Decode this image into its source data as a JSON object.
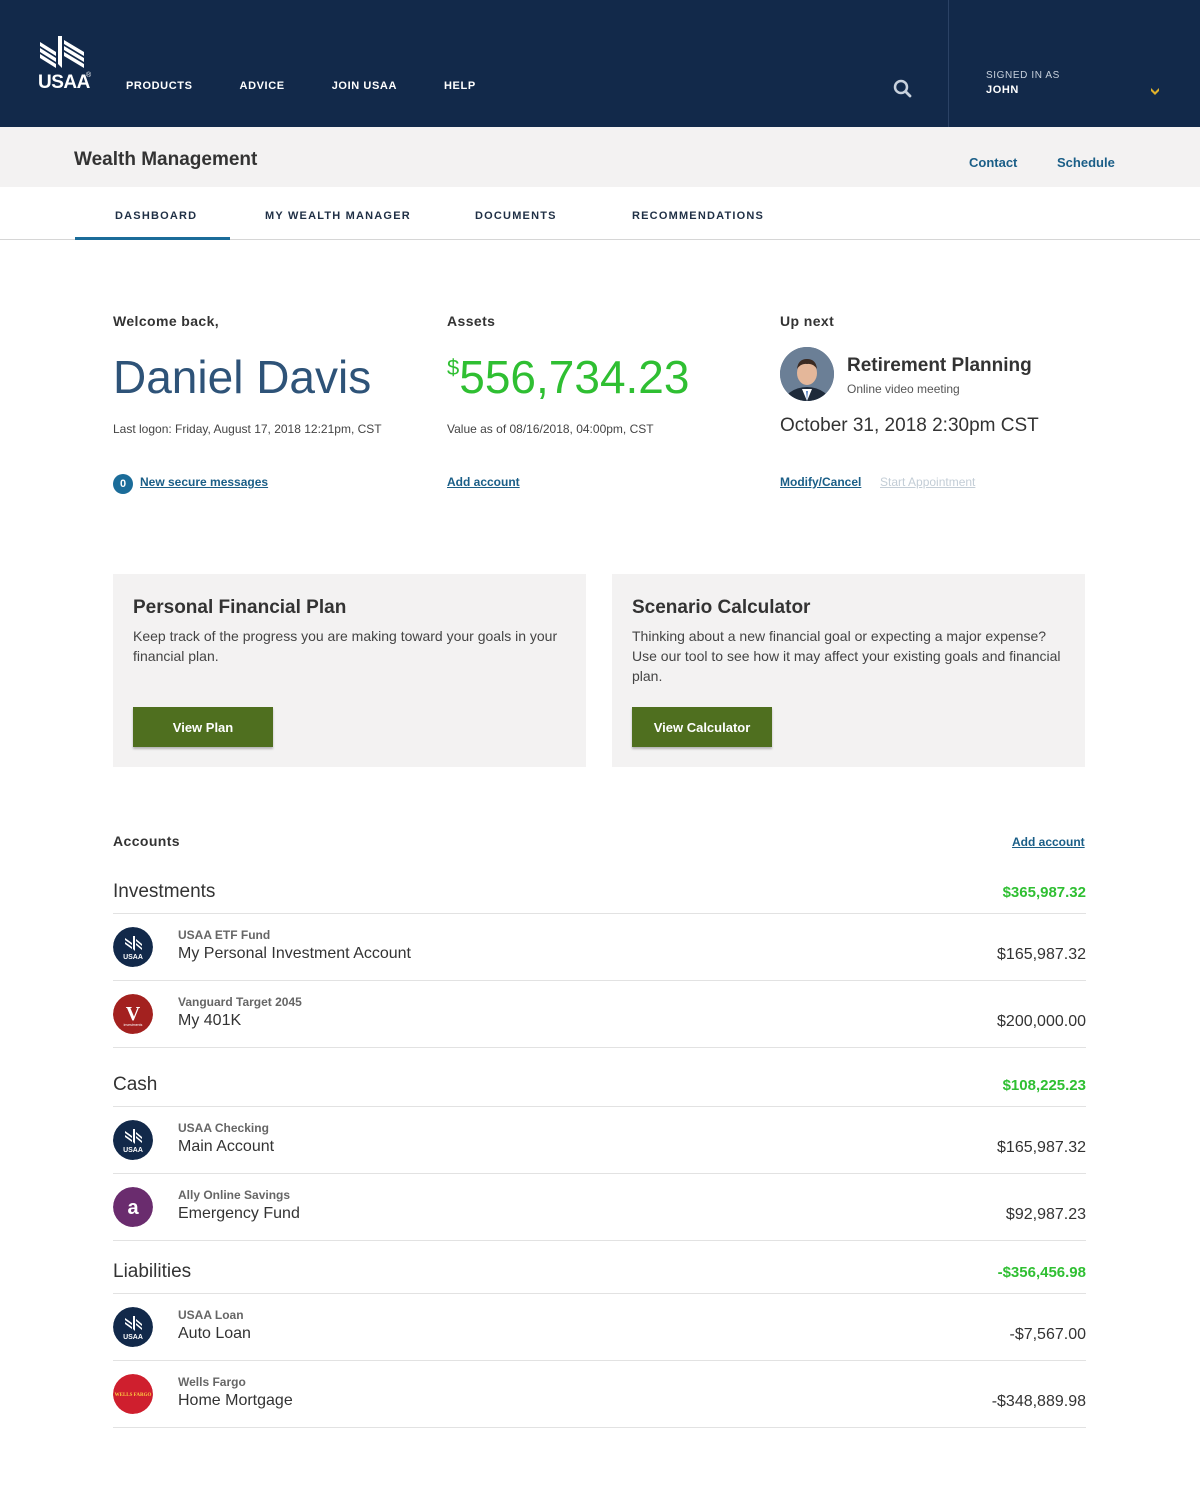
{
  "brand": {
    "name": "USAA",
    "reg": "®",
    "colors": {
      "navy": "#12294a",
      "green": "#2fbf32",
      "link": "#1a5e87",
      "button": "#4f6f1f"
    }
  },
  "topnav": [
    "PRODUCTS",
    "ADVICE",
    "JOIN USAA",
    "HELP"
  ],
  "user_menu": {
    "label": "SIGNED IN AS",
    "name": "JOHN"
  },
  "subheader": {
    "title": "Wealth Management",
    "contact": "Contact",
    "schedule": "Schedule"
  },
  "tabs": [
    "DASHBOARD",
    "MY WEALTH MANAGER",
    "DOCUMENTS",
    "RECOMMENDATIONS"
  ],
  "active_tab": "DASHBOARD",
  "welcome": {
    "label": "Welcome back,",
    "name": "Daniel Davis",
    "last_logon": "Last logon: Friday, August 17, 2018 12:21pm, CST",
    "message_count": "0",
    "messages_link": "New secure messages"
  },
  "assets": {
    "label": "Assets",
    "currency": "$",
    "value": "556,734.23",
    "as_of": "Value as of 08/16/2018, 04:00pm, CST",
    "add_link": "Add account"
  },
  "up_next": {
    "label": "Up next",
    "title": "Retirement Planning",
    "subtitle": "Online video meeting",
    "date": "October 31, 2018 2:30pm CST",
    "modify_link": "Modify/Cancel",
    "start_link": "Start Appointment"
  },
  "cards": [
    {
      "title": "Personal Financial Plan",
      "text": "Keep track of the progress you are making toward your goals in your financial plan.",
      "button": "View Plan"
    },
    {
      "title": "Scenario Calculator",
      "text": "Thinking about a new financial goal or expecting a major expense? Use our tool to see how it may affect your existing goals and financial plan.",
      "button": "View Calculator"
    }
  ],
  "accounts": {
    "label": "Accounts",
    "add_link": "Add account",
    "sections": [
      {
        "name": "Investments",
        "total": "$365,987.32",
        "rows": [
          {
            "institution": "USAA ETF Fund",
            "name": "My Personal Investment Account",
            "amount": "$165,987.32",
            "logo": "usaa"
          },
          {
            "institution": "Vanguard Target 2045",
            "name": "My 401K",
            "amount": "$200,000.00",
            "logo": "vanguard"
          }
        ]
      },
      {
        "name": "Cash",
        "total": "$108,225.23",
        "rows": [
          {
            "institution": "USAA Checking",
            "name": "Main Account",
            "amount": "$165,987.32",
            "logo": "usaa"
          },
          {
            "institution": "Ally Online Savings",
            "name": "Emergency Fund",
            "amount": "$92,987.23",
            "logo": "ally"
          }
        ]
      },
      {
        "name": "Liabilities",
        "total": "-$356,456.98",
        "rows": [
          {
            "institution": "USAA Loan",
            "name": "Auto Loan",
            "amount": "-$7,567.00",
            "logo": "usaa"
          },
          {
            "institution": "Wells Fargo",
            "name": "Home Mortgage",
            "amount": "-$348,889.98",
            "logo": "wellsfargo"
          }
        ]
      }
    ]
  },
  "logo_marks": {
    "usaa": "USAA",
    "vanguard": "V",
    "vanguard_sub": "investments",
    "ally": "a",
    "wellsfargo": "WELLS FARGO"
  }
}
